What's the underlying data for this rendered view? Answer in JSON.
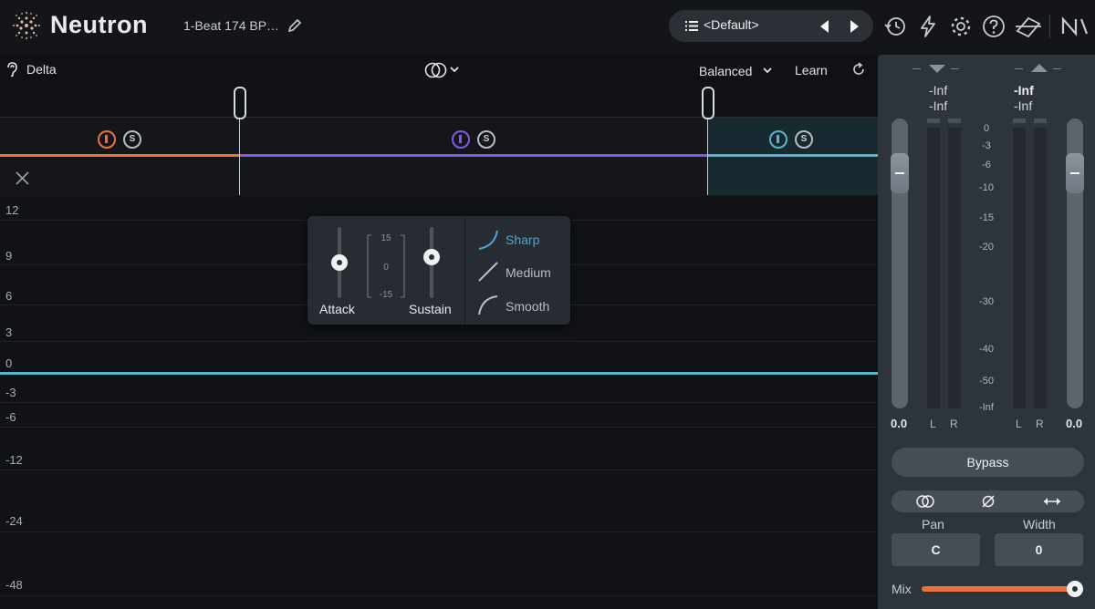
{
  "header": {
    "app_title": "Neutron",
    "preset_name": "1-Beat 174 BP…",
    "preset_selector": "<Default>"
  },
  "toolbar": {
    "delta_label": "Delta",
    "balanced_label": "Balanced",
    "learn_label": "Learn"
  },
  "bands": [
    {
      "solo_label": "S",
      "color": "#e8743c"
    },
    {
      "solo_label": "S",
      "color": "#7f5be6"
    },
    {
      "solo_label": "S",
      "color": "#56b6cc"
    }
  ],
  "graph": {
    "y_labels": [
      "12",
      "9",
      "6",
      "3",
      "0",
      "-3",
      "-6",
      "-12",
      "-24",
      "-48"
    ]
  },
  "popup": {
    "attack_label": "Attack",
    "sustain_label": "Sustain",
    "scale": [
      "15",
      "0",
      "-15"
    ],
    "attack_value_fraction": 0.5,
    "sustain_value_fraction": 0.6,
    "shapes": [
      {
        "label": "Sharp",
        "selected": true
      },
      {
        "label": "Medium",
        "selected": false
      },
      {
        "label": "Smooth",
        "selected": false
      }
    ],
    "accent": "#4aa8d8"
  },
  "output_panel": {
    "input_peak": [
      "-Inf",
      "-Inf"
    ],
    "output_peak": [
      "-Inf",
      "-Inf"
    ],
    "scale": [
      "0",
      "-3",
      "-6",
      "-10",
      "-15",
      "-20",
      "-30",
      "-40",
      "-50",
      "-Inf"
    ],
    "input_gain": "0.0",
    "output_gain": "0.0",
    "left_label": "L",
    "right_label": "R",
    "bypass_label": "Bypass",
    "pan_label": "Pan",
    "pan_value": "C",
    "width_label": "Width",
    "width_value": "0",
    "mix_label": "Mix",
    "mix_fraction": 1.0
  }
}
